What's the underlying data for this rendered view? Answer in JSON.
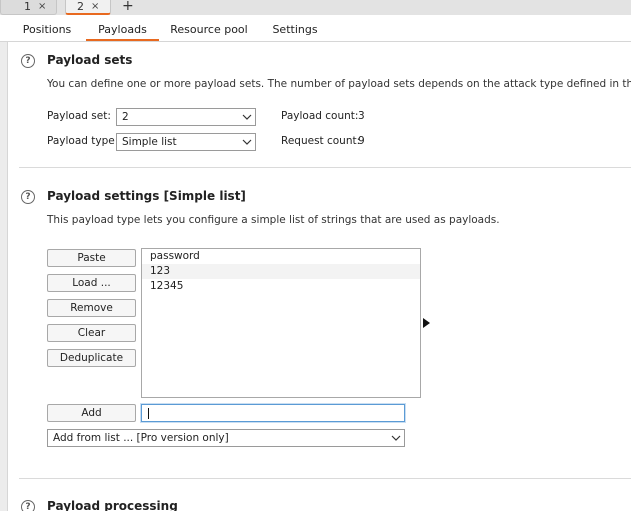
{
  "attack_tabs": [
    {
      "label": "1",
      "close": "×"
    },
    {
      "label": "2",
      "close": "×"
    }
  ],
  "add_tab": "+",
  "sub_tabs": [
    "Positions",
    "Payloads",
    "Resource pool",
    "Settings"
  ],
  "active_sub_tab": "Payloads",
  "colors": {
    "accent": "#e8691f",
    "focus": "#5b9bd5"
  },
  "help_glyph": "?",
  "payload_sets": {
    "title": "Payload sets",
    "description": "You can define one or more payload sets. The number of payload sets depends on the attack type defined in the Positions ta",
    "set_label": "Payload set:",
    "set_value": "2",
    "type_label": "Payload type:",
    "type_value": "Simple list",
    "count_label": "Payload count:",
    "count_value": "3",
    "request_label": "Request count:",
    "request_value": "9"
  },
  "payload_settings": {
    "title": "Payload settings [Simple list]",
    "description": "This payload type lets you configure a simple list of strings that are used as payloads.",
    "buttons": {
      "paste": "Paste",
      "load": "Load ...",
      "remove": "Remove",
      "clear": "Clear",
      "deduplicate": "Deduplicate",
      "add": "Add"
    },
    "list_items": [
      "password",
      "123",
      "12345"
    ],
    "add_input_value": "",
    "add_from_list": "Add from list ... [Pro version only]"
  },
  "payload_processing": {
    "title": "Payload processing"
  }
}
